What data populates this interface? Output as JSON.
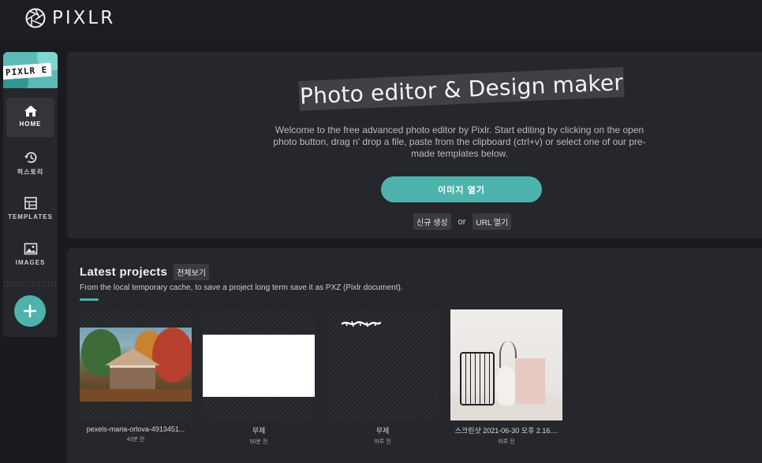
{
  "app": {
    "name": "PIXLR"
  },
  "sidebar": {
    "badge": "PIXLR E",
    "items": [
      {
        "label": "HOME",
        "icon": "home-icon",
        "active": true
      },
      {
        "label": "히스토리",
        "icon": "history-icon",
        "active": false
      },
      {
        "label": "TEMPLATES",
        "icon": "templates-icon",
        "active": false
      },
      {
        "label": "IMAGES",
        "icon": "images-icon",
        "active": false
      }
    ],
    "add_icon": "plus-icon"
  },
  "hero": {
    "title": "Photo editor & Design maker",
    "description": "Welcome to the free advanced photo editor by Pixlr. Start editing by clicking on the open photo button, drag n' drop a file, paste from the clipboard (ctrl+v) or select one of our pre-made templates below.",
    "open_button": "이미지 열기",
    "new_link": "신규 생성",
    "or_text": "or",
    "url_link": "URL 열기"
  },
  "projects": {
    "title": "Latest projects",
    "view_all": "전체보기",
    "subtitle": "From the local temporary cache, to save a project long term save it as PXZ (Pixlr document).",
    "cards": [
      {
        "name": "pexels-maria-orlova-4913451...",
        "time": "43분 전"
      },
      {
        "name": "무제",
        "time": "50분 전"
      },
      {
        "name": "무제",
        "time": "하루 전"
      },
      {
        "name": "스크린샷 2021-06-30 오후 2.16....",
        "time": "하루 전"
      }
    ]
  },
  "colors": {
    "accent": "#4fb3ad",
    "background": "#1a1b1f",
    "panel": "#26272c"
  }
}
